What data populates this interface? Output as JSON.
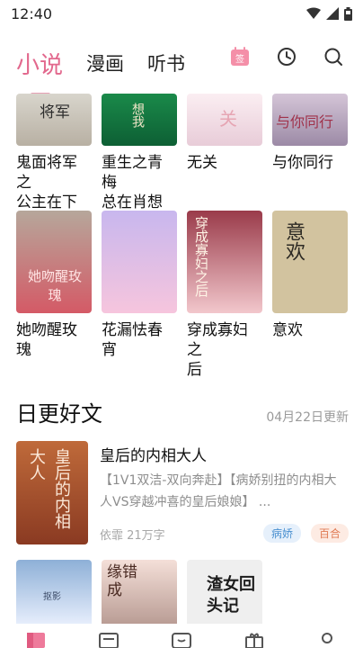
{
  "status_bar": {
    "time": "12:40"
  },
  "tabs": [
    {
      "label": "小说"
    },
    {
      "label": "漫画"
    },
    {
      "label": "听书"
    }
  ],
  "calendar_badge": "签",
  "books_row1": [
    {
      "title_line1": "鬼面将军之",
      "title_line2": "公主在下",
      "cover_text": "将军"
    },
    {
      "title_line1": "重生之青梅",
      "title_line2": "总在肖想我",
      "cover_text": "想我"
    },
    {
      "title_line1": "无关",
      "title_line2": "",
      "cover_text": "关"
    },
    {
      "title_line1": "与你同行",
      "title_line2": "",
      "cover_text": "与你同行"
    }
  ],
  "books_row2": [
    {
      "title_line1": "她吻醒玫瑰",
      "title_line2": "",
      "cover_text": "她吻醒玫瑰"
    },
    {
      "title_line1": "花漏怯春宵",
      "title_line2": "",
      "cover_text": ""
    },
    {
      "title_line1": "穿成寡妇之",
      "title_line2": "后",
      "cover_text": "穿成寡妇之后"
    },
    {
      "title_line1": "意欢",
      "title_line2": "",
      "cover_text": "意欢"
    }
  ],
  "daily_section": {
    "title": "日更好文",
    "date_text": "04月22日更新"
  },
  "featured_book": {
    "title": "皇后的内相大人",
    "description": "【1V1双洁-双向奔赴】【病娇别扭的内相大人VS穿越冲喜的皇后娘娘】 ...",
    "author_words": "依霏 21万字",
    "tags": [
      "病娇",
      "百合"
    ],
    "cover_text": "皇后的内相大人"
  },
  "peek_books": [
    {
      "cover_text": "抠影"
    },
    {
      "cover_text": "缘错成"
    },
    {
      "cover_text": "渣女回头记"
    }
  ],
  "colors": {
    "accent": "#e2688d",
    "tag_blue": "#4a90d0",
    "tag_pink": "#e07a53"
  }
}
